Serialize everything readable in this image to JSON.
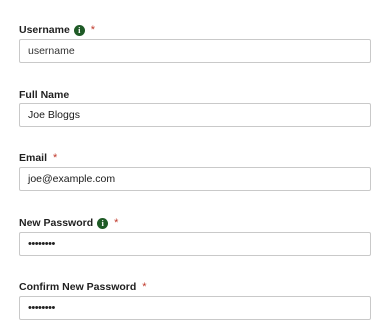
{
  "icons": {
    "info": "info-circle-icon",
    "info_glyph": "i",
    "required_marker": "*"
  },
  "colors": {
    "info_icon_bg": "#1e5a26",
    "required_star": "#c0392b",
    "input_border": "#c9c9c9"
  },
  "fields": [
    {
      "label": "Username",
      "has_info": true,
      "required": true,
      "value": "",
      "placeholder": "username",
      "type": "text"
    },
    {
      "label": "Full Name",
      "has_info": false,
      "required": false,
      "value": "Joe Bloggs",
      "type": "text"
    },
    {
      "label": "Email",
      "has_info": false,
      "required": true,
      "value": "joe@example.com",
      "type": "text"
    },
    {
      "label": "New Password",
      "has_info": true,
      "required": true,
      "value": "••••••••",
      "type": "password"
    },
    {
      "label": "Confirm New Password",
      "has_info": false,
      "required": true,
      "value": "••••••••",
      "type": "password"
    }
  ]
}
